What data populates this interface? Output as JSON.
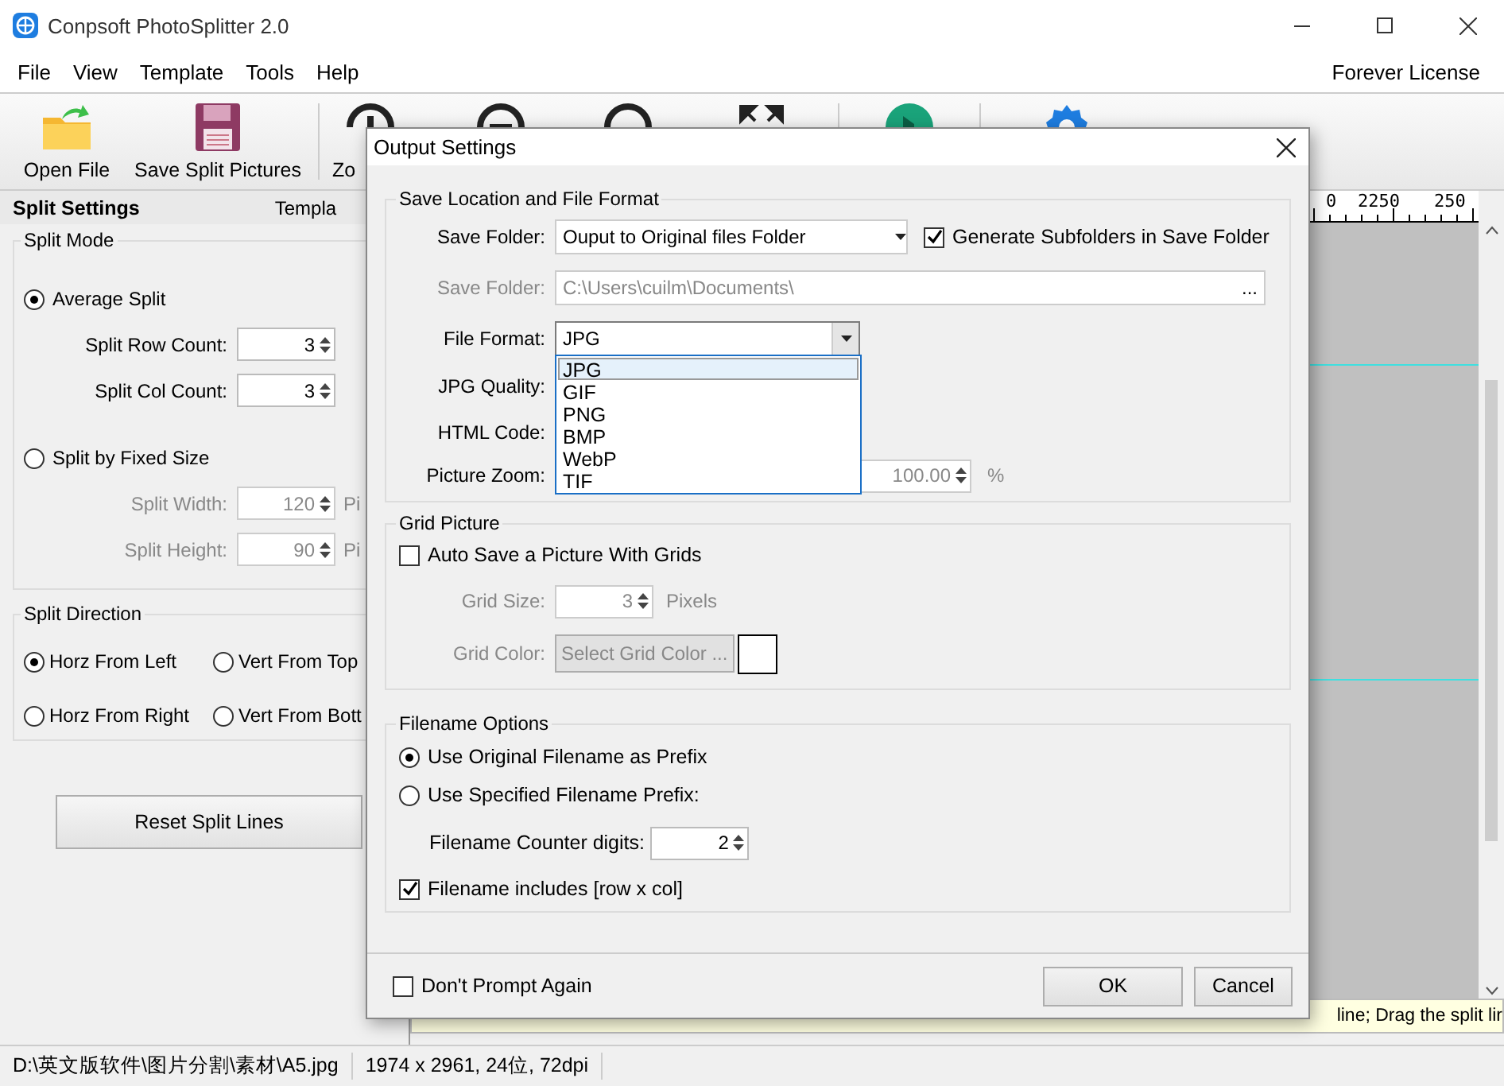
{
  "window": {
    "title": "Conpsoft PhotoSplitter 2.0"
  },
  "menu": {
    "items": [
      "File",
      "View",
      "Template",
      "Tools",
      "Help"
    ],
    "license": "Forever License"
  },
  "toolbar": [
    {
      "label": "Open File",
      "kind": "folder"
    },
    {
      "label": "Save Split Pictures",
      "kind": "floppy"
    },
    {
      "label": "Zo",
      "kind": "zoomin"
    },
    {
      "kind": "zoomout"
    },
    {
      "kind": "ring"
    },
    {
      "kind": "expand"
    },
    {
      "kind": "play"
    },
    {
      "kind": "gear"
    }
  ],
  "split_settings": {
    "title": "Split Settings",
    "tab": "Templa",
    "split_mode": {
      "title": "Split Mode",
      "options": [
        {
          "label": "Average Split",
          "selected": true,
          "fields": [
            {
              "label": "Split Row Count:",
              "value": "3"
            },
            {
              "label": "Split Col Count:",
              "value": "3"
            }
          ]
        },
        {
          "label": "Split by Fixed Size",
          "selected": false,
          "fields": [
            {
              "label": "Split Width:",
              "value": "120",
              "unit": "Pi"
            },
            {
              "label": "Split Height:",
              "value": "90",
              "unit": "Pi"
            }
          ]
        }
      ]
    },
    "split_direction": {
      "title": "Split Direction",
      "options": [
        {
          "label": "Horz From Left",
          "selected": true
        },
        {
          "label": "Vert From Top",
          "selected": false
        },
        {
          "label": "Horz From Right",
          "selected": false
        },
        {
          "label": "Vert From Bott",
          "selected": false
        }
      ]
    },
    "reset_button": "Reset Split Lines"
  },
  "ruler": {
    "labels": [
      "0",
      "2250",
      "250"
    ]
  },
  "help": "line; Drag the split lir",
  "status_bar": [
    "D:\\英文版软件\\图片分割\\素材\\A5.jpg",
    "1974 x 2961, 24位, 72dpi"
  ],
  "dialog": {
    "title": "Output Settings",
    "location": {
      "title": "Save Location and File Format",
      "save_folder": {
        "label": "Save Folder:",
        "value": "Ouput to Original files Folder"
      },
      "subfolders": {
        "label": "Generate Subfolders in Save Folder",
        "checked": true
      },
      "folder_path": {
        "label": "Save Folder:",
        "value": "C:\\Users\\cuilm\\Documents\\",
        "browse": "...",
        "disabled": true
      },
      "file_format": {
        "label": "File Format:",
        "value": "JPG",
        "expanded": true,
        "options": [
          {
            "label": "JPG",
            "selected": true
          },
          {
            "label": "GIF",
            "selected": false
          },
          {
            "label": "PNG",
            "selected": false
          },
          {
            "label": "BMP",
            "selected": false
          },
          {
            "label": "WebP",
            "selected": false
          },
          {
            "label": "TIF",
            "selected": false
          }
        ]
      },
      "jpg_quality": {
        "label": "JPG Quality:"
      },
      "html_code": {
        "label": "HTML Code:"
      },
      "picture_zoom": {
        "label": "Picture Zoom:",
        "value": "100.00",
        "unit": "%",
        "disabled": true
      }
    },
    "grid": {
      "title": "Grid Picture",
      "auto_save": {
        "label": "Auto Save a Picture With Grids",
        "checked": false
      },
      "grid_size": {
        "label": "Grid Size:",
        "value": "3",
        "unit": "Pixels"
      },
      "grid_color": {
        "label": "Grid Color:",
        "button": "Select Grid Color ..."
      }
    },
    "filename": {
      "title": "Filename Options",
      "prefix_options": [
        {
          "label": "Use Original Filename as Prefix",
          "selected": true
        },
        {
          "label": "Use Specified Filename Prefix:",
          "selected": false
        }
      ],
      "counter": {
        "label": "Filename Counter digits:",
        "value": "2"
      },
      "include_rowcol": {
        "label": "Filename includes [row x col]",
        "checked": true
      }
    },
    "dont_prompt": {
      "label": "Don't Prompt Again",
      "checked": false
    },
    "buttons": [
      "OK",
      "Cancel"
    ]
  }
}
